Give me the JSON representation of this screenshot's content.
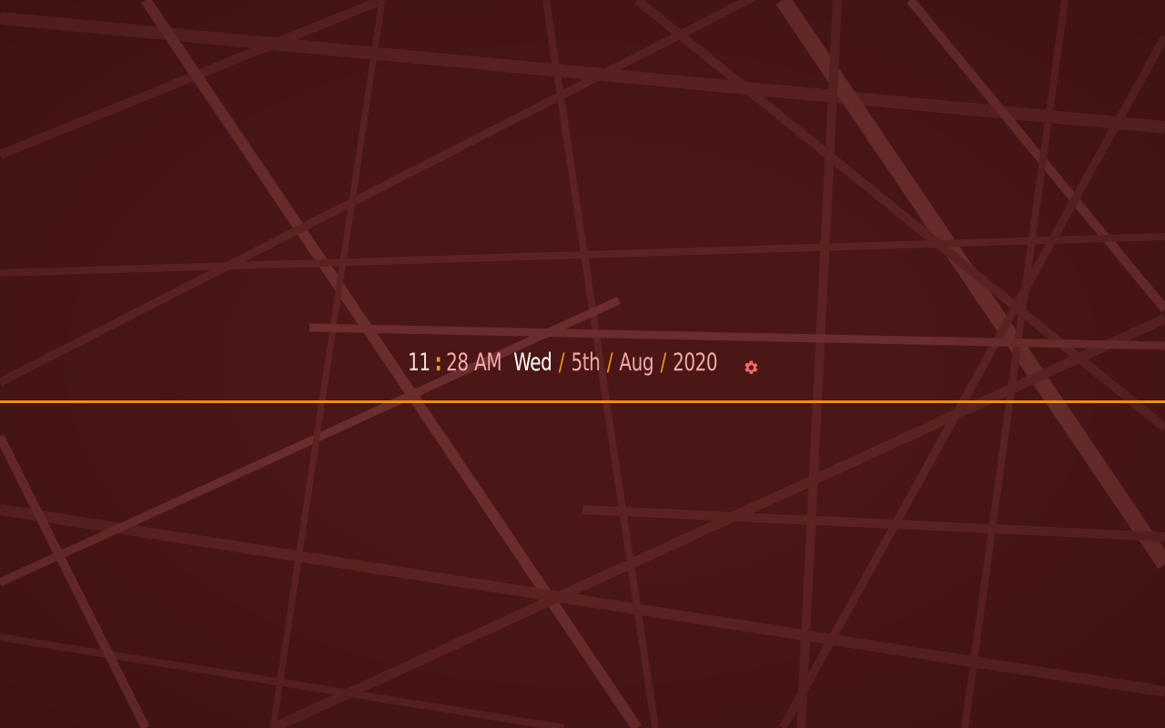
{
  "clock": {
    "hour": "11",
    "colon": ":",
    "minute": "28",
    "ampm": "AM",
    "day": "Wed",
    "sep": "/",
    "date_day": "5th",
    "month": "Aug",
    "year": "2020"
  },
  "settings": {
    "icon": "gear-icon"
  },
  "colors": {
    "background": "#4a1616",
    "accent": "#f08c1a",
    "text_light": "#f0a8a8",
    "text_bright": "#ffffff",
    "gear": "#e86b6b"
  }
}
